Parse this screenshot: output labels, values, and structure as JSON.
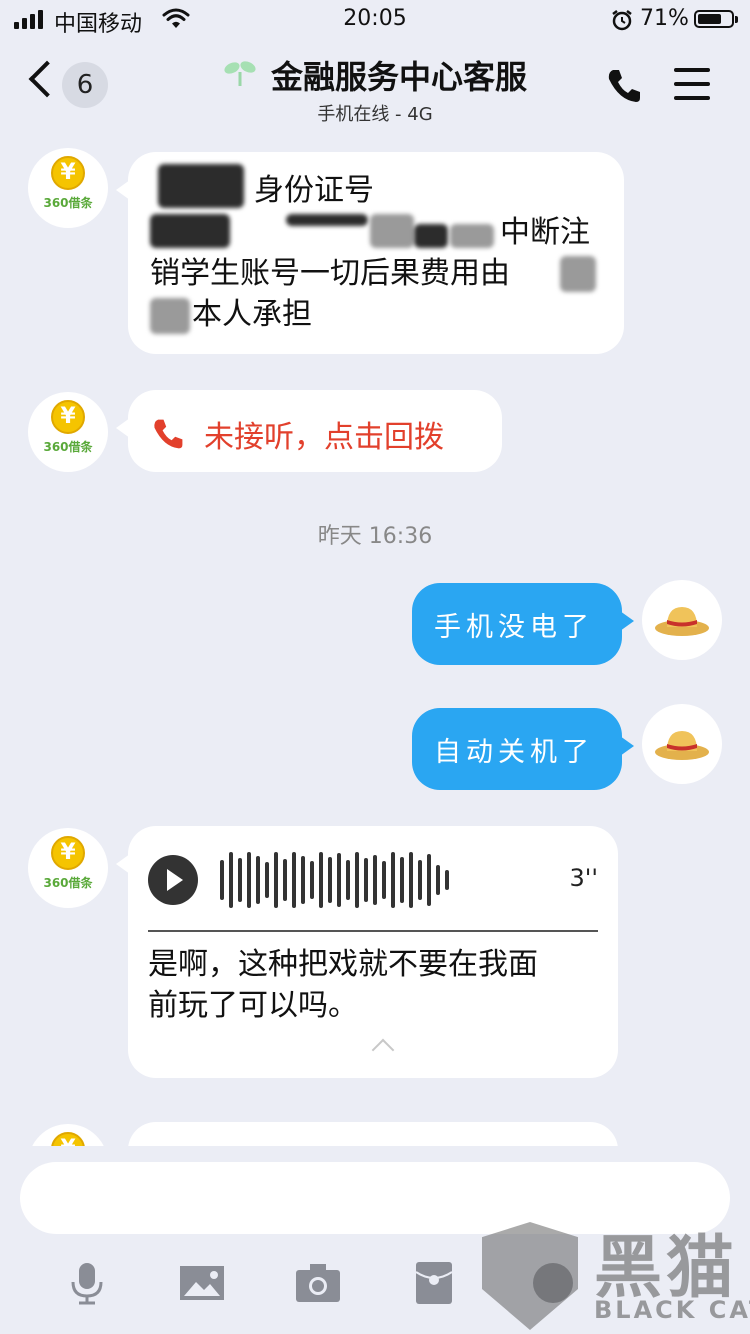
{
  "status_bar": {
    "carrier": "中国移动",
    "time": "20:05",
    "battery_percent": "71%",
    "battery_level": 0.71
  },
  "nav": {
    "back_count": "6",
    "title": "金融服务中心客服",
    "subtitle": "手机在线 - 4G",
    "title_icon": "sprout-icon",
    "call_icon": "phone-icon",
    "menu_icon": "menu-icon"
  },
  "contact": {
    "avatar_brand": "360借条",
    "avatar_symbol": "¥"
  },
  "messages": [
    {
      "sender": "contact",
      "type": "text",
      "lines": [
        "身份证号",
        "中断注",
        "销学生账号一切后果费用由",
        "本人承担"
      ],
      "redacted": true
    },
    {
      "sender": "contact",
      "type": "missed_call",
      "text": "未接听，点击回拨",
      "icon": "phone-icon"
    },
    {
      "type": "timestamp",
      "text": "昨天 16:36"
    },
    {
      "sender": "me",
      "type": "text",
      "text": "手机没电了"
    },
    {
      "sender": "me",
      "type": "text",
      "text": "自动关机了"
    },
    {
      "sender": "contact",
      "type": "voice",
      "duration": "3''",
      "transcript": "是啊，这种把戏就不要在我面\n前玩了可以吗。"
    }
  ],
  "input": {
    "placeholder": "",
    "value": ""
  },
  "toolbar": {
    "icons": [
      "microphone-icon",
      "image-icon",
      "camera-icon",
      "red-packet-icon",
      "emoji-icon"
    ]
  },
  "watermark": {
    "title": "黑猫",
    "subtitle": "BLACK CAT"
  },
  "colors": {
    "background": "#ebedf5",
    "my_bubble": "#2aa6f2",
    "missed_call": "#e2402c",
    "brand_green": "#5aa93a",
    "coin_yellow": "#f5c400"
  }
}
